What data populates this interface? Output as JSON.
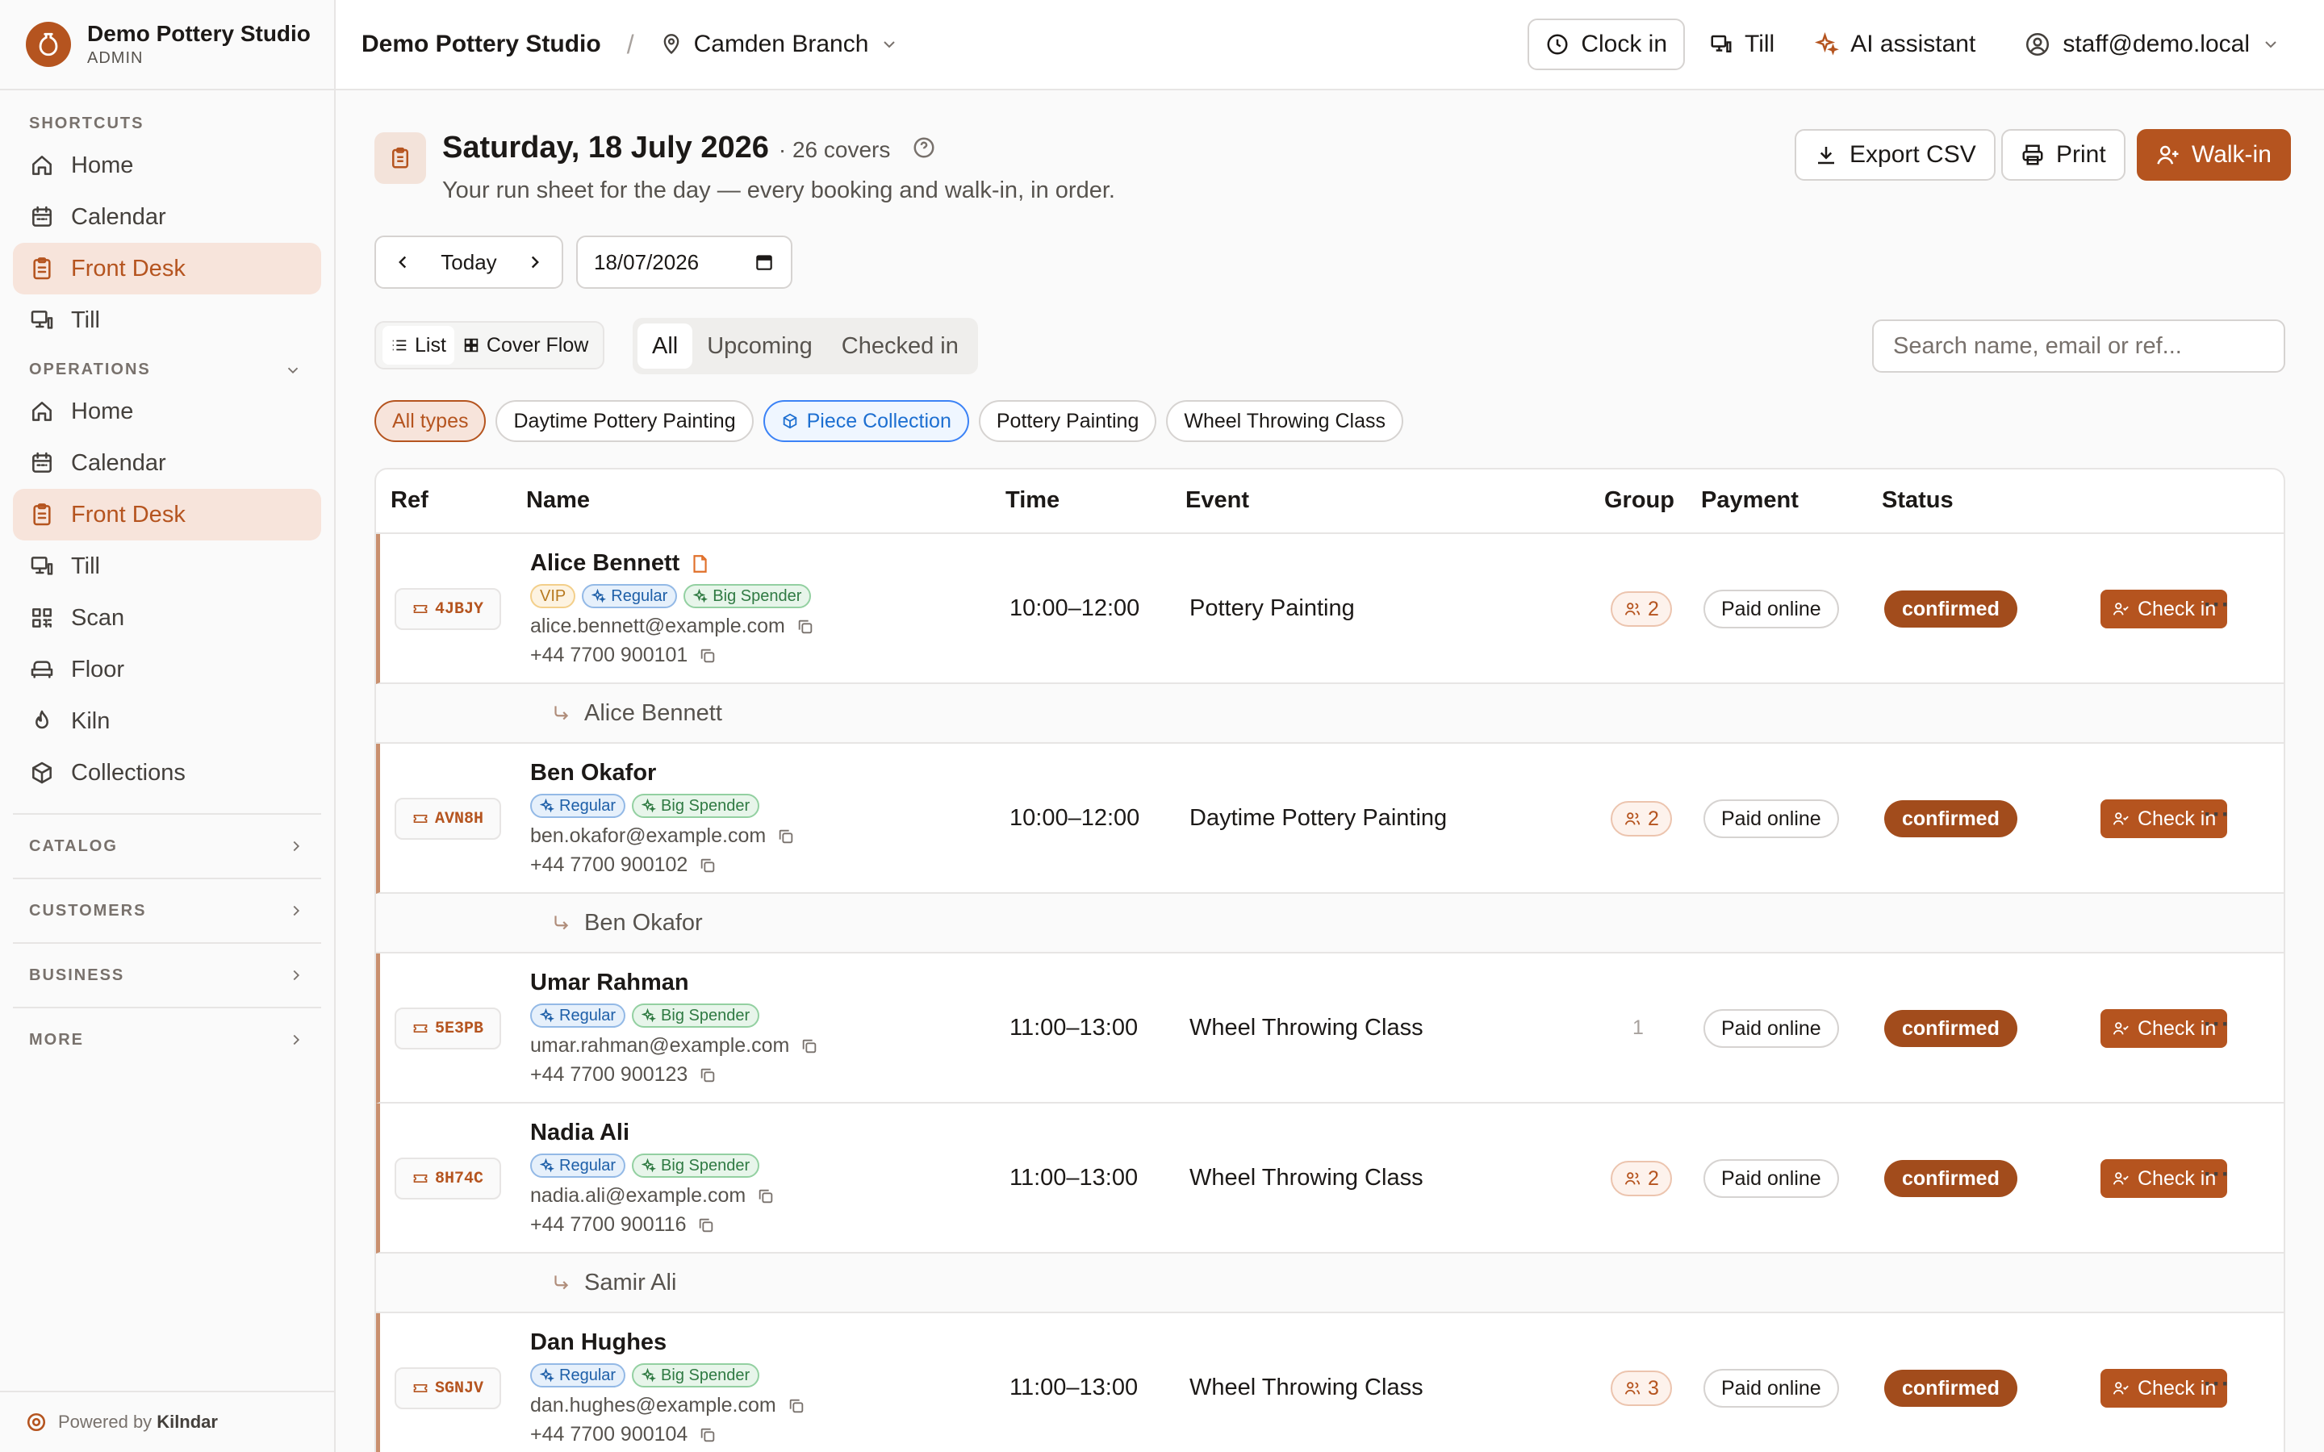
{
  "sidebar": {
    "brand_name": "Demo Pottery Studio",
    "brand_role": "ADMIN",
    "shortcuts_label": "SHORTCUTS",
    "shortcuts": [
      {
        "label": "Home",
        "icon": "home-icon"
      },
      {
        "label": "Calendar",
        "icon": "calendar-icon"
      },
      {
        "label": "Front Desk",
        "icon": "clipboard-icon",
        "active": true
      },
      {
        "label": "Till",
        "icon": "till-icon"
      }
    ],
    "operations_label": "OPERATIONS",
    "operations": [
      {
        "label": "Home",
        "icon": "home-icon"
      },
      {
        "label": "Calendar",
        "icon": "calendar-icon"
      },
      {
        "label": "Front Desk",
        "icon": "clipboard-icon",
        "active": true
      },
      {
        "label": "Till",
        "icon": "till-icon"
      },
      {
        "label": "Scan",
        "icon": "qr-icon"
      },
      {
        "label": "Floor",
        "icon": "floor-icon"
      },
      {
        "label": "Kiln",
        "icon": "flame-icon"
      },
      {
        "label": "Collections",
        "icon": "package-icon"
      }
    ],
    "collapsed_sections": [
      "CATALOG",
      "CUSTOMERS",
      "BUSINESS",
      "MORE"
    ],
    "powered_prefix": "Powered by",
    "powered_brand": "Kilndar"
  },
  "header": {
    "studio": "Demo Pottery Studio",
    "separator": "/",
    "branch": "Camden Branch",
    "clock_in": "Clock in",
    "till": "Till",
    "ai": "AI assistant",
    "user": "staff@demo.local"
  },
  "page": {
    "title": "Saturday, 18 July 2026",
    "covers": "· 26 covers",
    "subtitle": "Your run sheet for the day — every booking and walk-in, in order.",
    "export": "Export CSV",
    "print": "Print",
    "walkin": "Walk-in",
    "today": "Today",
    "date_value": "18/07/2026",
    "view_list": "List",
    "view_cover": "Cover Flow",
    "tabs": [
      "All",
      "Upcoming",
      "Checked in"
    ],
    "search_placeholder": "Search name, email or ref...",
    "chips": [
      "All types",
      "Daytime Pottery Painting",
      "Piece Collection",
      "Pottery Painting",
      "Wheel Throwing Class"
    ]
  },
  "table": {
    "headers": {
      "ref": "Ref",
      "name": "Name",
      "time": "Time",
      "event": "Event",
      "group": "Group",
      "payment": "Payment",
      "status": "Status"
    },
    "check_in_label": "Check in",
    "rows": [
      {
        "ref": "4JBJY",
        "name": "Alice Bennett",
        "tags": [
          "VIP",
          "Regular",
          "Big Spender"
        ],
        "email": "alice.bennett@example.com",
        "phone": "+44 7700 900101",
        "time": "10:00–12:00",
        "event": "Pottery Painting",
        "group": "2",
        "payment": "Paid online",
        "status": "confirmed",
        "guest": "Alice Bennett"
      },
      {
        "ref": "AVN8H",
        "name": "Ben Okafor",
        "tags": [
          "Regular",
          "Big Spender"
        ],
        "email": "ben.okafor@example.com",
        "phone": "+44 7700 900102",
        "time": "10:00–12:00",
        "event": "Daytime Pottery Painting",
        "group": "2",
        "payment": "Paid online",
        "status": "confirmed",
        "guest": "Ben Okafor"
      },
      {
        "ref": "5E3PB",
        "name": "Umar Rahman",
        "tags": [
          "Regular",
          "Big Spender"
        ],
        "email": "umar.rahman@example.com",
        "phone": "+44 7700 900123",
        "time": "11:00–13:00",
        "event": "Wheel Throwing Class",
        "group": "1",
        "payment": "Paid online",
        "status": "confirmed"
      },
      {
        "ref": "8H74C",
        "name": "Nadia Ali",
        "tags": [
          "Regular",
          "Big Spender"
        ],
        "email": "nadia.ali@example.com",
        "phone": "+44 7700 900116",
        "time": "11:00–13:00",
        "event": "Wheel Throwing Class",
        "group": "2",
        "payment": "Paid online",
        "status": "confirmed",
        "guest": "Samir Ali"
      },
      {
        "ref": "SGNJV",
        "name": "Dan Hughes",
        "tags": [
          "Regular",
          "Big Spender"
        ],
        "email": "dan.hughes@example.com",
        "phone": "+44 7700 900104",
        "time": "11:00–13:00",
        "event": "Wheel Throwing Class",
        "group": "3",
        "payment": "Paid online",
        "status": "confirmed"
      }
    ]
  },
  "colors": {
    "accent": "#b5541f",
    "status": "#a24c1c",
    "active_bg": "#f7e4db"
  }
}
